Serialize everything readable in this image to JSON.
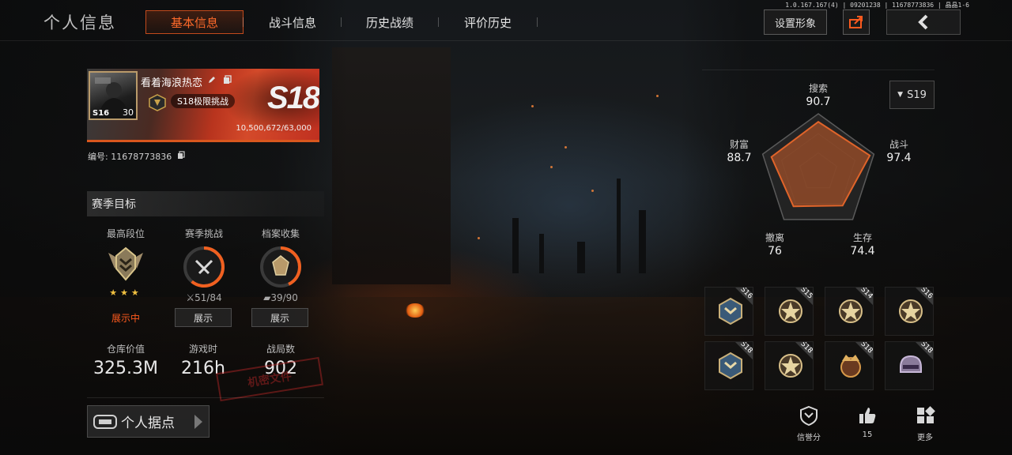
{
  "header": {
    "page_title": "个人信息",
    "tabs": [
      {
        "label": "基本信息",
        "active": true
      },
      {
        "label": "战斗信息",
        "active": false
      },
      {
        "label": "历史战绩",
        "active": false
      },
      {
        "label": "评价历史",
        "active": false
      }
    ],
    "outfit_button": "设置形象",
    "version_text": "1.0.167.167(4) | 09201238 | 11678773836 | 晶晶1-6"
  },
  "profile": {
    "avatar_tag": "S16",
    "level": "30",
    "nickname": "看着海浪热恋",
    "challenge": "S18极限挑战",
    "season_badge": "S18",
    "exp": "10,500,672/63,000",
    "player_id": "编号: 11678773836"
  },
  "season_goals": {
    "title": "赛季目标",
    "columns": [
      {
        "title": "最高段位",
        "progress": "",
        "stars": "★★★",
        "action": "展示中",
        "action_state": "live"
      },
      {
        "title": "赛季挑战",
        "progress": "51/84",
        "progress_fraction": 0.61,
        "action": "展示",
        "action_state": "button"
      },
      {
        "title": "档案收集",
        "progress": "39/90",
        "progress_fraction": 0.43,
        "action": "展示",
        "action_state": "button"
      }
    ]
  },
  "stats": [
    {
      "label": "仓库价值",
      "value": "325.3M"
    },
    {
      "label": "游戏时",
      "value": "216h"
    },
    {
      "label": "战局数",
      "value": "902"
    }
  ],
  "watermark_text": "机密文件",
  "base_button": "个人据点",
  "radar": {
    "season": "S19",
    "axes": [
      {
        "label": "搜索",
        "value": "90.7"
      },
      {
        "label": "战斗",
        "value": "97.4"
      },
      {
        "label": "生存",
        "value": "74.4"
      },
      {
        "label": "撤离",
        "value": "76"
      },
      {
        "label": "财富",
        "value": "88.7"
      }
    ],
    "fill_color": "#a0502a",
    "stroke_color": "#e0642a"
  },
  "medals": [
    {
      "season": "S16",
      "icon": "blue-rank-medal-icon"
    },
    {
      "season": "S15",
      "icon": "star-medal-icon"
    },
    {
      "season": "S14",
      "icon": "star-medal-icon"
    },
    {
      "season": "S16",
      "icon": "star-medal-icon"
    },
    {
      "season": "S18",
      "icon": "blue-rank-medal-icon"
    },
    {
      "season": "S18",
      "icon": "star-medal-icon"
    },
    {
      "season": "S18",
      "icon": "crown-medal-icon"
    },
    {
      "season": "S18",
      "icon": "helmet-medal-icon"
    }
  ],
  "bottom_actions": [
    {
      "label": "信誉分",
      "icon": "shield-icon"
    },
    {
      "label": "15",
      "icon": "thumbs-up-icon"
    },
    {
      "label": "更多",
      "icon": "grid-more-icon"
    }
  ],
  "accent_color": "#ff5a1e"
}
